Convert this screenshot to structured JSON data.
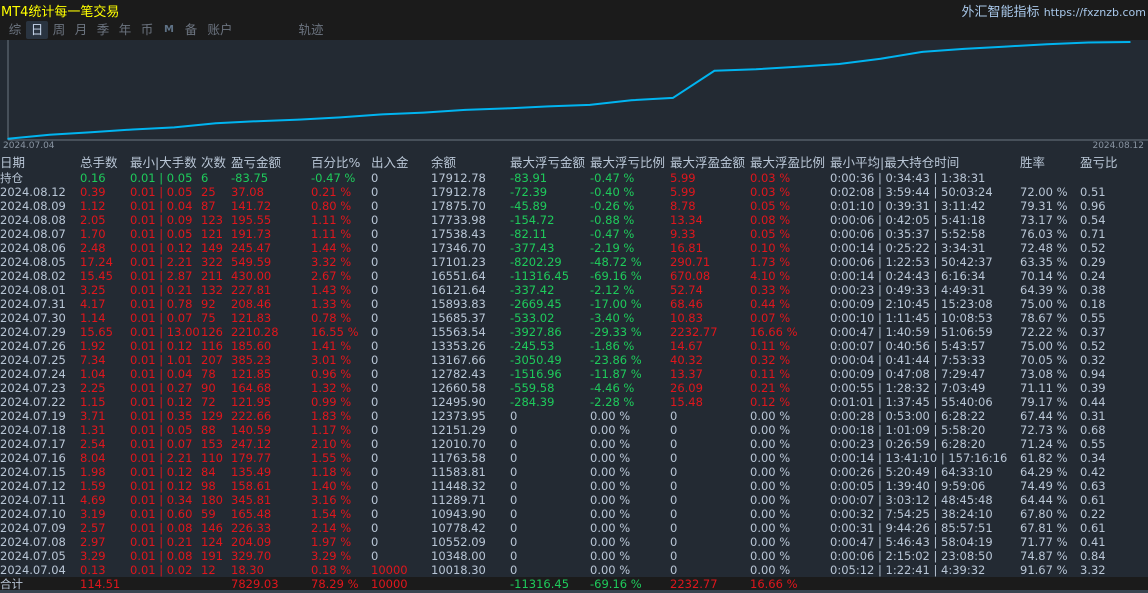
{
  "title": "MT4统计每一笔交易",
  "brand": {
    "name": "外汇智能指标",
    "url": "https://fxznzb.com"
  },
  "tabs": [
    {
      "label": "综"
    },
    {
      "label": "日",
      "active": true
    },
    {
      "label": "周"
    },
    {
      "label": "月"
    },
    {
      "label": "季"
    },
    {
      "label": "年"
    },
    {
      "label": "币"
    },
    {
      "label": "M"
    },
    {
      "label": "备"
    },
    {
      "label": "账户"
    },
    {
      "label": "轨迹"
    }
  ],
  "colors": {
    "background": "#232a33",
    "profit": "#e0161c",
    "loss": "#1ecb5b",
    "curve": "#00b4f0",
    "title": "#ffff00"
  },
  "chart_data": {
    "type": "line",
    "x_start_label": "2024.07.04",
    "x_end_label": "2024.08.12",
    "x": [
      "2024.07.04",
      "2024.07.05",
      "2024.07.08",
      "2024.07.09",
      "2024.07.10",
      "2024.07.11",
      "2024.07.12",
      "2024.07.15",
      "2024.07.16",
      "2024.07.17",
      "2024.07.18",
      "2024.07.19",
      "2024.07.22",
      "2024.07.23",
      "2024.07.24",
      "2024.07.25",
      "2024.07.26",
      "2024.07.29",
      "2024.07.30",
      "2024.07.31",
      "2024.08.01",
      "2024.08.02",
      "2024.08.05",
      "2024.08.06",
      "2024.08.07",
      "2024.08.08",
      "2024.08.09",
      "2024.08.12"
    ],
    "values": [
      10018.3,
      10348.0,
      10552.09,
      10778.42,
      10943.9,
      11289.71,
      11448.32,
      11583.81,
      11763.58,
      12010.7,
      12151.29,
      12373.95,
      12495.9,
      12660.58,
      12782.43,
      13167.66,
      13353.26,
      15563.54,
      15685.37,
      15893.83,
      16121.64,
      16551.64,
      17101.23,
      17346.7,
      17538.43,
      17733.98,
      17875.7,
      17912.78
    ],
    "ylim": [
      10000,
      17912.78
    ],
    "grid": false
  },
  "table": {
    "headers": [
      "日期",
      "总手数",
      "最小|大手数",
      "次数",
      "盈亏金额",
      "百分比%",
      "出入金",
      "余额",
      "最大浮亏金额",
      "最大浮亏比例",
      "最大浮盈金额",
      "最大浮盈比例",
      "最小平均|最大持仓时间",
      "胜率",
      "盈亏比"
    ],
    "hold": [
      "持仓",
      "0.16",
      "0.01 | 0.05",
      "6",
      "-83.75",
      "-0.47 %",
      "0",
      "17912.78",
      "-83.91",
      "-0.47 %",
      "5.99",
      "0.03 %",
      "0:00:36 | 0:34:43 | 1:38:31",
      "",
      ""
    ],
    "rows": [
      [
        "2024.08.12",
        "0.39",
        "0.01 | 0.05",
        "25",
        "37.08",
        "0.21 %",
        "0",
        "17912.78",
        "-72.39",
        "-0.40 %",
        "5.99",
        "0.03 %",
        "0:02:08 | 3:59:44 | 50:03:24",
        "72.00 %",
        "0.51"
      ],
      [
        "2024.08.09",
        "1.12",
        "0.01 | 0.04",
        "87",
        "141.72",
        "0.80 %",
        "0",
        "17875.70",
        "-45.89",
        "-0.26 %",
        "8.78",
        "0.05 %",
        "0:01:10 | 0:39:31 | 3:11:42",
        "79.31 %",
        "0.96"
      ],
      [
        "2024.08.08",
        "2.05",
        "0.01 | 0.09",
        "123",
        "195.55",
        "1.11 %",
        "0",
        "17733.98",
        "-154.72",
        "-0.88 %",
        "13.34",
        "0.08 %",
        "0:00:06 | 0:42:05 | 5:41:18",
        "73.17 %",
        "0.54"
      ],
      [
        "2024.08.07",
        "1.70",
        "0.01 | 0.05",
        "121",
        "191.73",
        "1.11 %",
        "0",
        "17538.43",
        "-82.11",
        "-0.47 %",
        "9.33",
        "0.05 %",
        "0:00:06 | 0:35:37 | 5:52:58",
        "76.03 %",
        "0.71"
      ],
      [
        "2024.08.06",
        "2.48",
        "0.01 | 0.12",
        "149",
        "245.47",
        "1.44 %",
        "0",
        "17346.70",
        "-377.43",
        "-2.19 %",
        "16.81",
        "0.10 %",
        "0:00:14 | 0:25:22 | 3:34:31",
        "72.48 %",
        "0.52"
      ],
      [
        "2024.08.05",
        "17.24",
        "0.01 | 2.21",
        "322",
        "549.59",
        "3.32 %",
        "0",
        "17101.23",
        "-8202.29",
        "-48.72 %",
        "290.71",
        "1.73 %",
        "0:00:06 | 1:22:53 | 50:42:37",
        "63.35 %",
        "0.29"
      ],
      [
        "2024.08.02",
        "15.45",
        "0.01 | 2.87",
        "211",
        "430.00",
        "2.67 %",
        "0",
        "16551.64",
        "-11316.45",
        "-69.16 %",
        "670.08",
        "4.10 %",
        "0:00:14 | 0:24:43 | 6:16:34",
        "70.14 %",
        "0.24"
      ],
      [
        "2024.08.01",
        "3.25",
        "0.01 | 0.21",
        "132",
        "227.81",
        "1.43 %",
        "0",
        "16121.64",
        "-337.42",
        "-2.12 %",
        "52.74",
        "0.33 %",
        "0:00:23 | 0:49:33 | 4:49:31",
        "64.39 %",
        "0.38"
      ],
      [
        "2024.07.31",
        "4.17",
        "0.01 | 0.78",
        "92",
        "208.46",
        "1.33 %",
        "0",
        "15893.83",
        "-2669.45",
        "-17.00 %",
        "68.46",
        "0.44 %",
        "0:00:09 | 2:10:45 | 15:23:08",
        "75.00 %",
        "0.18"
      ],
      [
        "2024.07.30",
        "1.14",
        "0.01 | 0.07",
        "75",
        "121.83",
        "0.78 %",
        "0",
        "15685.37",
        "-533.02",
        "-3.40 %",
        "10.83",
        "0.07 %",
        "0:00:10 | 1:11:45 | 10:08:53",
        "78.67 %",
        "0.55"
      ],
      [
        "2024.07.29",
        "15.65",
        "0.01 | 13.00",
        "126",
        "2210.28",
        "16.55 %",
        "0",
        "15563.54",
        "-3927.86",
        "-29.33 %",
        "2232.77",
        "16.66 %",
        "0:00:47 | 1:40:59 | 51:06:59",
        "72.22 %",
        "0.37"
      ],
      [
        "2024.07.26",
        "1.92",
        "0.01 | 0.12",
        "116",
        "185.60",
        "1.41 %",
        "0",
        "13353.26",
        "-245.53",
        "-1.86 %",
        "14.67",
        "0.11 %",
        "0:00:07 | 0:40:56 | 5:43:57",
        "75.00 %",
        "0.52"
      ],
      [
        "2024.07.25",
        "7.34",
        "0.01 | 1.01",
        "207",
        "385.23",
        "3.01 %",
        "0",
        "13167.66",
        "-3050.49",
        "-23.86 %",
        "40.32",
        "0.32 %",
        "0:00:04 | 0:41:44 | 7:53:33",
        "70.05 %",
        "0.32"
      ],
      [
        "2024.07.24",
        "1.04",
        "0.01 | 0.04",
        "78",
        "121.85",
        "0.96 %",
        "0",
        "12782.43",
        "-1516.96",
        "-11.87 %",
        "13.37",
        "0.11 %",
        "0:00:09 | 0:47:08 | 7:29:47",
        "73.08 %",
        "0.94"
      ],
      [
        "2024.07.23",
        "2.25",
        "0.01 | 0.27",
        "90",
        "164.68",
        "1.32 %",
        "0",
        "12660.58",
        "-559.58",
        "-4.46 %",
        "26.09",
        "0.21 %",
        "0:00:55 | 1:28:32 | 7:03:49",
        "71.11 %",
        "0.39"
      ],
      [
        "2024.07.22",
        "1.15",
        "0.01 | 0.12",
        "72",
        "121.95",
        "0.99 %",
        "0",
        "12495.90",
        "-284.39",
        "-2.28 %",
        "15.48",
        "0.12 %",
        "0:01:01 | 1:37:45 | 55:40:06",
        "79.17 %",
        "0.44"
      ],
      [
        "2024.07.19",
        "3.71",
        "0.01 | 0.35",
        "129",
        "222.66",
        "1.83 %",
        "0",
        "12373.95",
        "0",
        "0.00 %",
        "0",
        "0.00 %",
        "0:00:28 | 0:53:00 | 6:28:22",
        "67.44 %",
        "0.31"
      ],
      [
        "2024.07.18",
        "1.31",
        "0.01 | 0.05",
        "88",
        "140.59",
        "1.17 %",
        "0",
        "12151.29",
        "0",
        "0.00 %",
        "0",
        "0.00 %",
        "0:00:18 | 1:01:09 | 5:58:20",
        "72.73 %",
        "0.68"
      ],
      [
        "2024.07.17",
        "2.54",
        "0.01 | 0.07",
        "153",
        "247.12",
        "2.10 %",
        "0",
        "12010.70",
        "0",
        "0.00 %",
        "0",
        "0.00 %",
        "0:00:23 | 0:26:59 | 6:28:20",
        "71.24 %",
        "0.55"
      ],
      [
        "2024.07.16",
        "8.04",
        "0.01 | 2.21",
        "110",
        "179.77",
        "1.55 %",
        "0",
        "11763.58",
        "0",
        "0.00 %",
        "0",
        "0.00 %",
        "0:00:14 | 13:41:10 | 157:16:16",
        "61.82 %",
        "0.34"
      ],
      [
        "2024.07.15",
        "1.98",
        "0.01 | 0.12",
        "84",
        "135.49",
        "1.18 %",
        "0",
        "11583.81",
        "0",
        "0.00 %",
        "0",
        "0.00 %",
        "0:00:26 | 5:20:49 | 64:33:10",
        "64.29 %",
        "0.42"
      ],
      [
        "2024.07.12",
        "1.59",
        "0.01 | 0.12",
        "98",
        "158.61",
        "1.40 %",
        "0",
        "11448.32",
        "0",
        "0.00 %",
        "0",
        "0.00 %",
        "0:00:05 | 1:39:40 | 9:59:06",
        "74.49 %",
        "0.63"
      ],
      [
        "2024.07.11",
        "4.69",
        "0.01 | 0.34",
        "180",
        "345.81",
        "3.16 %",
        "0",
        "11289.71",
        "0",
        "0.00 %",
        "0",
        "0.00 %",
        "0:00:07 | 3:03:12 | 48:45:48",
        "64.44 %",
        "0.61"
      ],
      [
        "2024.07.10",
        "3.19",
        "0.01 | 0.60",
        "59",
        "165.48",
        "1.54 %",
        "0",
        "10943.90",
        "0",
        "0.00 %",
        "0",
        "0.00 %",
        "0:00:32 | 7:54:25 | 38:24:10",
        "67.80 %",
        "0.22"
      ],
      [
        "2024.07.09",
        "2.57",
        "0.01 | 0.08",
        "146",
        "226.33",
        "2.14 %",
        "0",
        "10778.42",
        "0",
        "0.00 %",
        "0",
        "0.00 %",
        "0:00:31 | 9:44:26 | 85:57:51",
        "67.81 %",
        "0.61"
      ],
      [
        "2024.07.08",
        "2.97",
        "0.01 | 0.21",
        "124",
        "204.09",
        "1.97 %",
        "0",
        "10552.09",
        "0",
        "0.00 %",
        "0",
        "0.00 %",
        "0:00:47 | 5:46:43 | 58:04:19",
        "71.77 %",
        "0.41"
      ],
      [
        "2024.07.05",
        "3.29",
        "0.01 | 0.08",
        "191",
        "329.70",
        "3.29 %",
        "0",
        "10348.00",
        "0",
        "0.00 %",
        "0",
        "0.00 %",
        "0:00:06 | 2:15:02 | 23:08:50",
        "74.87 %",
        "0.84"
      ],
      [
        "2024.07.04",
        "0.13",
        "0.01 | 0.02",
        "12",
        "18.30",
        "0.18 %",
        "10000",
        "10018.30",
        "0",
        "0.00 %",
        "0",
        "0.00 %",
        "0:05:12 | 1:22:41 | 4:39:32",
        "91.67 %",
        "3.32"
      ]
    ],
    "total": [
      "合计",
      "114.51",
      "",
      "",
      "7829.03",
      "78.29 %",
      "10000",
      "",
      "-11316.45",
      "-69.16 %",
      "2232.77",
      "16.66 %",
      "",
      "",
      ""
    ]
  }
}
